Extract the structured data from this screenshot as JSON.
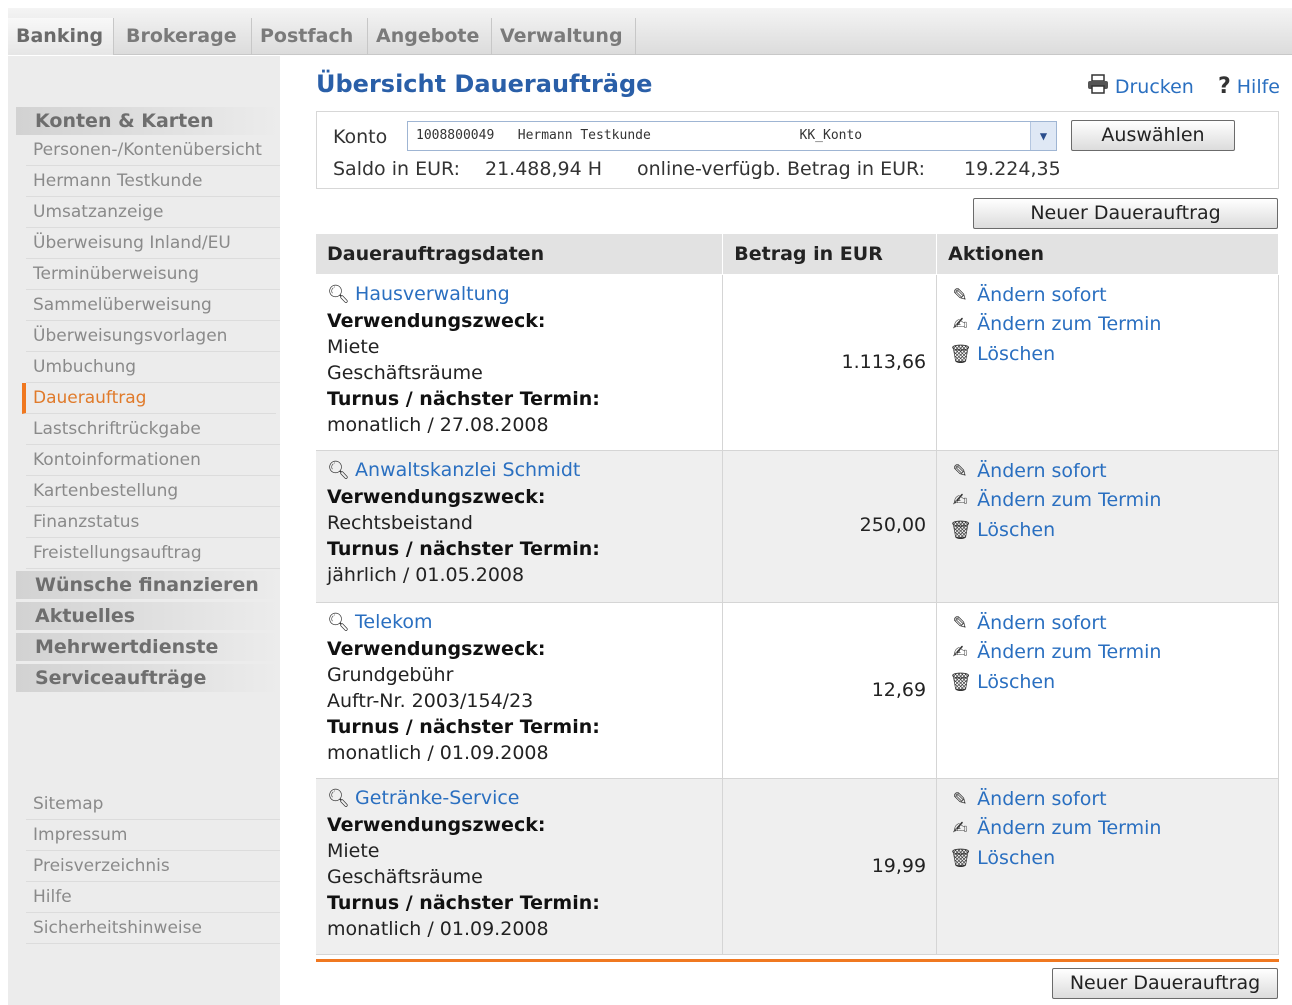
{
  "topnav": {
    "tabs": [
      "Banking",
      "Brokerage",
      "Postfach",
      "Angebote",
      "Verwaltung"
    ]
  },
  "sidebar": {
    "section1": "Konten & Karten",
    "items": [
      "Personen-/Kontenübersicht",
      "Hermann Testkunde",
      "Umsatzanzeige",
      "Überweisung Inland/EU",
      "Terminüberweisung",
      "Sammelüberweisung",
      "Überweisungsvorlagen",
      "Umbuchung",
      "Dauerauftrag",
      "Lastschriftrückgabe",
      "Kontoinformationen",
      "Kartenbestellung",
      "Finanzstatus",
      "Freistellungsauftrag"
    ],
    "sections": [
      "Wünsche finanzieren",
      "Aktuelles",
      "Mehrwertdienste",
      "Serviceaufträge"
    ],
    "footer_items": [
      "Sitemap",
      "Impressum",
      "Preisverzeichnis",
      "Hilfe",
      "Sicherheitshinweise"
    ]
  },
  "page": {
    "title": "Übersicht Daueraufträge",
    "print_label": "Drucken",
    "help_label": "Hilfe"
  },
  "konto": {
    "label": "Konto",
    "selected": "1008800049   Hermann Testkunde                   KK_Konto",
    "select_button": "Auswählen",
    "saldo_label": "Saldo in EUR:",
    "saldo_value": "21.488,94 H",
    "available_label": "online-verfügb. Betrag in EUR:",
    "available_value": "19.224,35"
  },
  "new_order_button": "Neuer Dauerauftrag",
  "table": {
    "headers": [
      "Dauerauftragsdaten",
      "Betrag in EUR",
      "Aktionen"
    ],
    "purpose_label": "Verwendungszweck:",
    "schedule_label": "Turnus / nächster Termin:",
    "actions": [
      "Ändern sofort",
      "Ändern zum Termin",
      "Löschen"
    ],
    "rows": [
      {
        "name": "Hausverwaltung",
        "purpose1": "Miete",
        "purpose2": "Geschäftsräume",
        "schedule": "monatlich / 27.08.2008",
        "amount": "1.113,66"
      },
      {
        "name": "Anwaltskanzlei Schmidt",
        "purpose1": "Rechtsbeistand",
        "purpose2": "",
        "schedule": "jährlich / 01.05.2008",
        "amount": "250,00"
      },
      {
        "name": "Telekom",
        "purpose1": "Grundgebühr",
        "purpose2": "Auftr-Nr. 2003/154/23",
        "schedule": "monatlich / 01.09.2008",
        "amount": "12,69"
      },
      {
        "name": "Getränke-Service",
        "purpose1": "Miete",
        "purpose2": "Geschäftsräume",
        "schedule": "monatlich / 01.09.2008",
        "amount": "19,99"
      }
    ]
  }
}
